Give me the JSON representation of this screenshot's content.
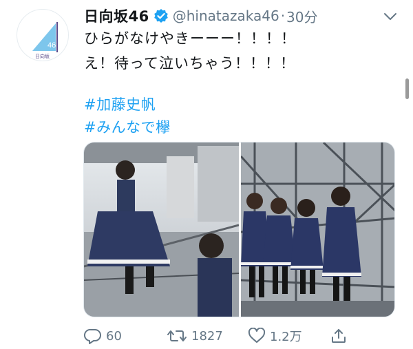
{
  "tweet": {
    "display_name": "日向坂46",
    "handle": "@hinatazaka46",
    "separator": "·",
    "time": "30分",
    "lines": [
      "ひらがなけやきーーー！！！！",
      "え！待って泣いちゃう！！！！"
    ],
    "hashtags": [
      "#加藤史帆",
      "#みんなで欅"
    ],
    "avatar_logo_text": "46",
    "avatar_logo_sub": "日向坂"
  },
  "actions": {
    "reply_count": "60",
    "retweet_count": "1827",
    "like_count": "1.2万"
  },
  "colors": {
    "link": "#1da1f2",
    "muted": "#657786",
    "logo_blue": "#7dc6ec",
    "logo_purple": "#5a4a8a"
  }
}
